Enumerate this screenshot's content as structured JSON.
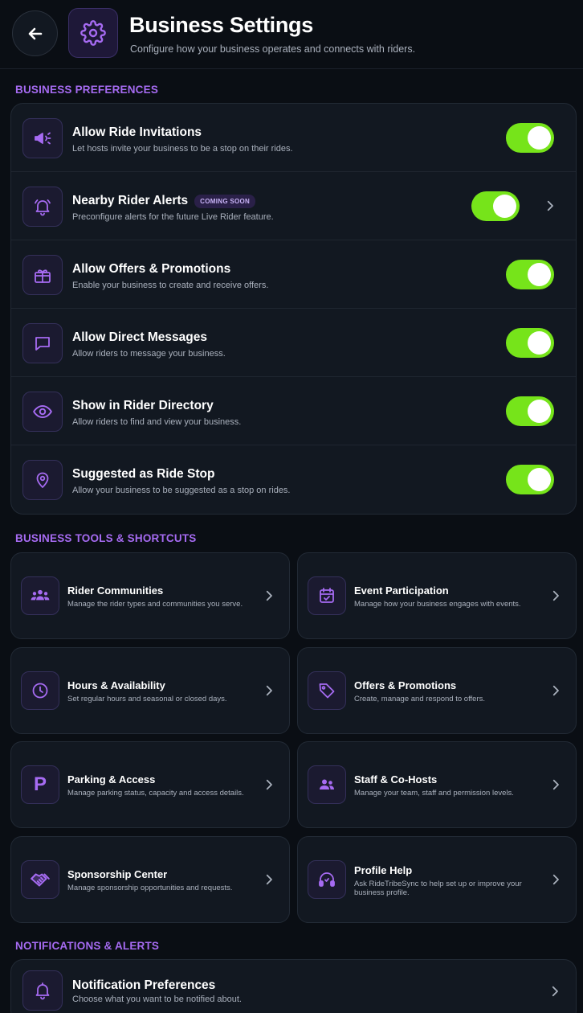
{
  "header": {
    "title": "Business Settings",
    "subtitle": "Configure how your business operates and connects with riders."
  },
  "sections": {
    "preferences": "BUSINESS PREFERENCES",
    "tools": "BUSINESS TOOLS & SHORTCUTS",
    "notifications": "NOTIFICATIONS & ALERTS"
  },
  "preferences": [
    {
      "icon": "megaphone-icon",
      "title": "Allow Ride Invitations",
      "subtitle": "Let hosts invite your business to be a stop on their rides.",
      "enabled": true
    },
    {
      "icon": "bell-alert-icon",
      "title": "Nearby Rider Alerts",
      "badge": "COMING SOON",
      "subtitle": "Preconfigure alerts for the future Live Rider feature.",
      "enabled": true
    },
    {
      "icon": "gift-icon",
      "title": "Allow Offers & Promotions",
      "subtitle": "Enable your business to create and receive offers.",
      "enabled": true
    },
    {
      "icon": "chat-bubble-icon",
      "title": "Allow Direct Messages",
      "subtitle": "Allow riders to message your business.",
      "enabled": true
    },
    {
      "icon": "eye-icon",
      "title": "Show in Rider Directory",
      "subtitle": "Allow riders to find and view your business.",
      "enabled": true
    },
    {
      "icon": "map-pin-icon",
      "title": "Suggested as Ride Stop",
      "subtitle": "Allow your business to be suggested as a stop on rides.",
      "enabled": true
    }
  ],
  "tools": [
    {
      "icon": "group-icon",
      "title": "Rider Communities",
      "subtitle": "Manage the rider types and communities you serve."
    },
    {
      "icon": "calendar-check-icon",
      "title": "Event Participation",
      "subtitle": "Manage how your business engages with events."
    },
    {
      "icon": "clock-icon",
      "title": "Hours & Availability",
      "subtitle": "Set regular hours and seasonal or closed days."
    },
    {
      "icon": "tag-icon",
      "title": "Offers & Promotions",
      "subtitle": "Create, manage and respond to offers."
    },
    {
      "icon": "parking-icon",
      "title": "Parking & Access",
      "subtitle": "Manage parking status, capacity and access details.",
      "glyph": "P"
    },
    {
      "icon": "people-icon",
      "title": "Staff & Co-Hosts",
      "subtitle": "Manage your team, staff and permission levels."
    },
    {
      "icon": "handshake-icon",
      "title": "Sponsorship Center",
      "subtitle": "Manage sponsorship opportunities and requests."
    },
    {
      "icon": "headset-icon",
      "title": "Profile Help",
      "subtitle": "Ask RideTribeSync to help set up or improve your business profile."
    }
  ],
  "notifications": {
    "icon": "bell-icon",
    "title": "Notification Preferences",
    "subtitle": "Choose what you want to be notified about."
  },
  "colors": {
    "accent": "#a66bf2",
    "toggle_on": "#76e41a",
    "background": "#0a0e14",
    "card": "#121821"
  }
}
